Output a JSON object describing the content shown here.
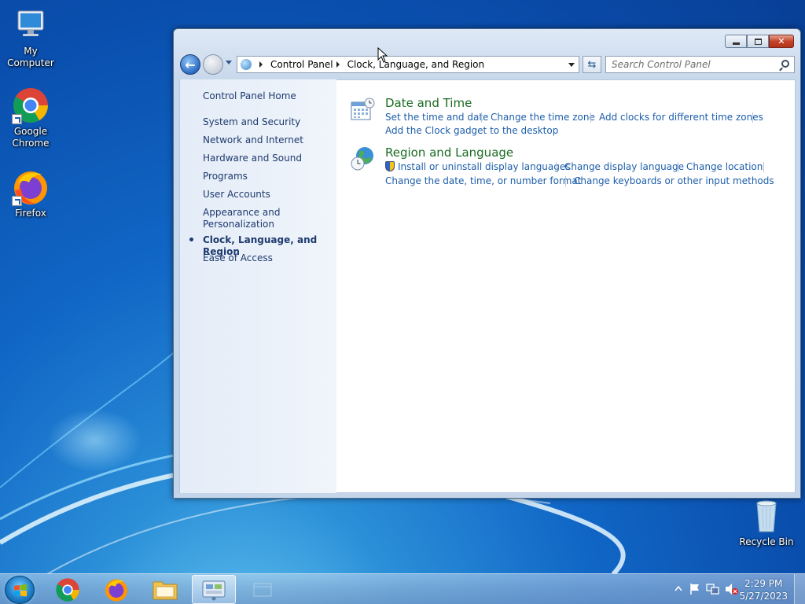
{
  "desktop": {
    "icons": [
      {
        "label": "My Computer"
      },
      {
        "label": "Google Chrome"
      },
      {
        "label": "Firefox"
      },
      {
        "label": "Recycle Bin"
      }
    ]
  },
  "window": {
    "address": {
      "crumbs": [
        "Control Panel",
        "Clock, Language, and Region"
      ]
    },
    "search": {
      "placeholder": "Search Control Panel"
    },
    "sidebar": {
      "home": "Control Panel Home",
      "items": [
        "System and Security",
        "Network and Internet",
        "Hardware and Sound",
        "Programs",
        "User Accounts",
        "Appearance and",
        "Personalization",
        "Clock, Language, and Region",
        "Ease of Access"
      ]
    },
    "categories": [
      {
        "title": "Date and Time",
        "links": [
          "Set the time and date",
          "Change the time zone",
          "Add clocks for different time zones",
          "Add the Clock gadget to the desktop"
        ]
      },
      {
        "title": "Region and Language",
        "links": [
          "Install or uninstall display languages",
          "Change display language",
          "Change location",
          "Change the date, time, or number format",
          "Change keyboards or other input methods"
        ]
      }
    ]
  },
  "taskbar": {
    "clock": {
      "time": "2:29 PM",
      "date": "5/27/2023"
    }
  },
  "colors": {
    "link": "#1d5eaa",
    "category_title": "#1a6b21",
    "sidebar_text": "#1e3a6e"
  }
}
